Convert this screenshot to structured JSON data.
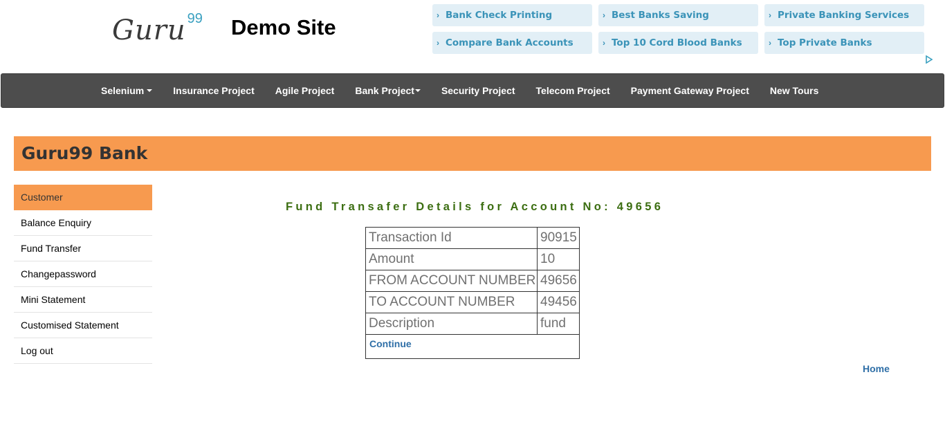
{
  "header": {
    "logo": {
      "text": "Guru",
      "superscript": "99"
    },
    "site_title": "Demo Site"
  },
  "ads": [
    {
      "label": "Bank Check Printing"
    },
    {
      "label": "Best Banks Saving"
    },
    {
      "label": "Private Banking Services"
    },
    {
      "label": "Compare Bank Accounts"
    },
    {
      "label": "Top 10 Cord Blood Banks"
    },
    {
      "label": "Top Private Banks"
    }
  ],
  "ad_chevron": "›",
  "navbar": {
    "items": [
      {
        "label": "Selenium",
        "dropdown": true
      },
      {
        "label": "Insurance Project"
      },
      {
        "label": "Agile Project"
      },
      {
        "label": "Bank Project",
        "dropdown": true
      },
      {
        "label": "Security Project"
      },
      {
        "label": "Telecom Project"
      },
      {
        "label": "Payment Gateway Project"
      },
      {
        "label": "New Tours"
      }
    ]
  },
  "banner": {
    "title": "Guru99 Bank"
  },
  "sidebar": {
    "items": [
      {
        "label": "Customer",
        "active": true
      },
      {
        "label": "Balance Enquiry"
      },
      {
        "label": "Fund Transfer"
      },
      {
        "label": "Changepassword"
      },
      {
        "label": "Mini Statement"
      },
      {
        "label": "Customised Statement"
      },
      {
        "label": "Log out"
      }
    ]
  },
  "main": {
    "heading": "Fund Transafer Details for Account No: 49656",
    "details": [
      {
        "label": "Transaction Id",
        "value": "90915"
      },
      {
        "label": "Amount",
        "value": "10"
      },
      {
        "label": "FROM ACCOUNT NUMBER",
        "value": "49656"
      },
      {
        "label": "TO ACCOUNT NUMBER",
        "value": "49456"
      },
      {
        "label": "Description",
        "value": "fund"
      }
    ],
    "continue_label": "Continue",
    "home_label": "Home"
  },
  "colors": {
    "accent": "#f79a4f",
    "navbar": "#4d4d4d",
    "heading": "#3c6e12",
    "link": "#2f6fa7",
    "ad_text": "#3a93b8"
  }
}
